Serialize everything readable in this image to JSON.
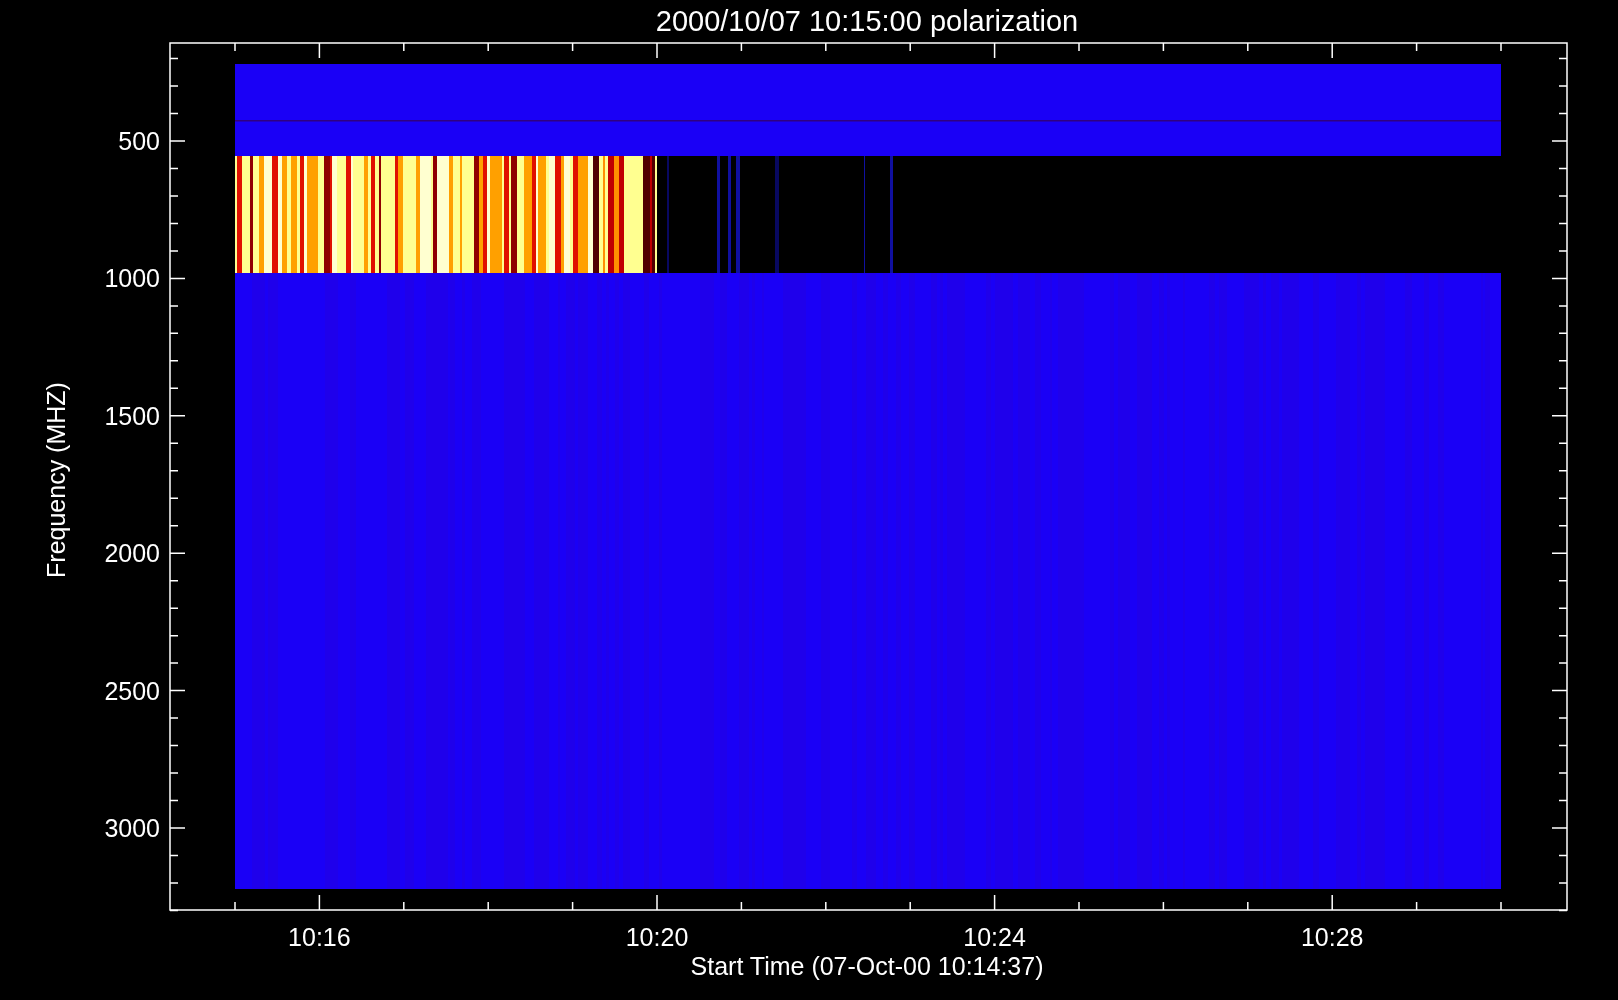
{
  "title": "2000/10/07 10:15:00 polarization",
  "xlabel": "Start Time (07-Oct-00 10:14:37)",
  "ylabel": "Frequency (MHZ)",
  "xticks": [
    {
      "label": "10:16"
    },
    {
      "label": "10:20"
    },
    {
      "label": "10:24"
    },
    {
      "label": "10:28"
    }
  ],
  "yticks": [
    {
      "label": "500"
    },
    {
      "label": "1000"
    },
    {
      "label": "1500"
    },
    {
      "label": "2000"
    },
    {
      "label": "2500"
    },
    {
      "label": "3000"
    }
  ]
}
